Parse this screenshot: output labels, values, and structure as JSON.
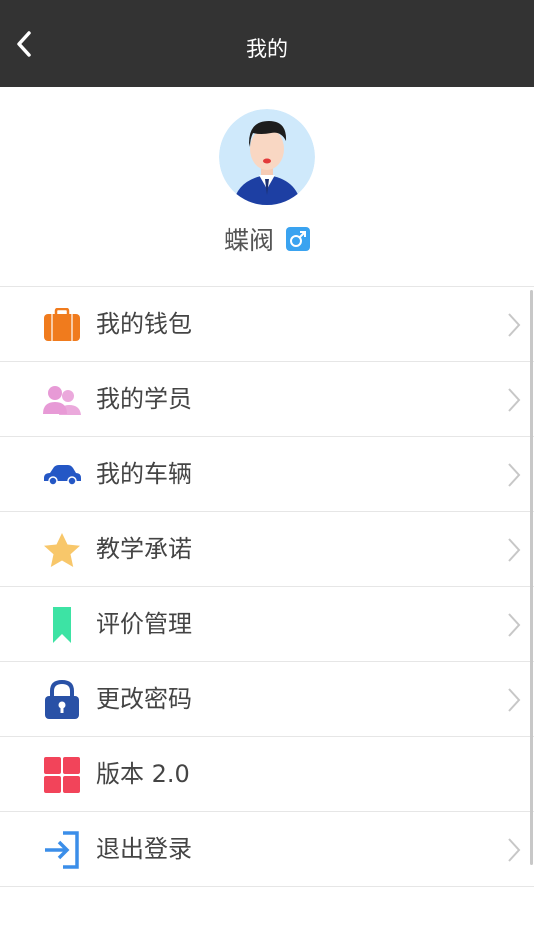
{
  "header": {
    "title": "我的",
    "back_icon": "chevron-left-icon"
  },
  "profile": {
    "name": "蝶阀",
    "gender_symbol": "♂",
    "gender_color": "#3aa3f0"
  },
  "menu": [
    {
      "label": "我的钱包",
      "icon": "wallet-icon",
      "color": "#f07b1d",
      "chevron": true
    },
    {
      "label": "我的学员",
      "icon": "students-icon",
      "color": "#e79ad6",
      "chevron": true
    },
    {
      "label": "我的车辆",
      "icon": "car-icon",
      "color": "#2457c5",
      "chevron": true
    },
    {
      "label": "教学承诺",
      "icon": "star-icon",
      "color": "#f8c76a",
      "chevron": true
    },
    {
      "label": "评价管理",
      "icon": "bookmark-icon",
      "color": "#3de3a4",
      "chevron": true
    },
    {
      "label": "更改密码",
      "icon": "lock-icon",
      "color": "#2951a6",
      "chevron": true
    },
    {
      "label": "版本 2.0",
      "icon": "grid-icon",
      "color": "#f2445a",
      "chevron": false
    },
    {
      "label": "退出登录",
      "icon": "logout-icon",
      "color": "#3b8ee9",
      "chevron": true
    }
  ]
}
